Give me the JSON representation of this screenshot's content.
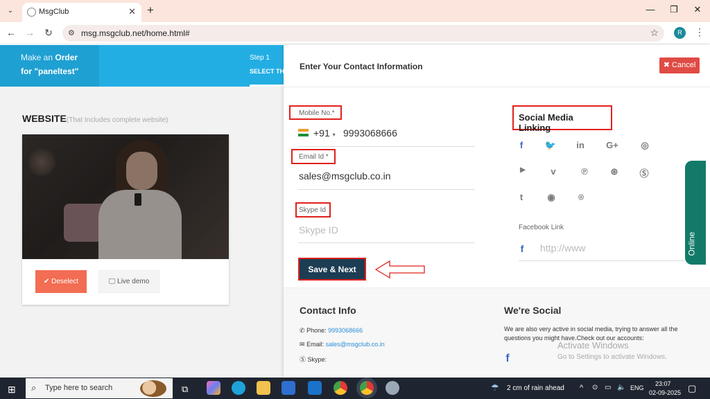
{
  "browser": {
    "tab_title": "MsgClub",
    "url": "msg.msgclub.net/home.html#",
    "profile_initial": "R"
  },
  "order_header": {
    "make_prefix": "Make an ",
    "order_word": "Order",
    "for_line": "for \"paneltest\"",
    "step": "Step 1",
    "step_title": "SELECT TH"
  },
  "website": {
    "title": "WEBSITE",
    "subtitle": "(That Includes complete website)",
    "deselect_label": "Deselect",
    "live_demo_label": "Live demo"
  },
  "panel": {
    "title": "Enter Your Contact Information",
    "cancel_label": "Cancel",
    "mobile_label": "Mobile No.*",
    "country_code": "+91",
    "mobile_value": "9993068666",
    "email_label": "Email Id *",
    "email_value": "sales@msgclub.co.in",
    "skype_label": "Skype Id",
    "skype_placeholder": "Skype ID",
    "save_label": "Save & Next",
    "social_title": "Social Media Linking",
    "facebook_label": "Facebook Link",
    "facebook_placeholder": "http://www"
  },
  "online_label": "Online",
  "footer": {
    "contact_title": "Contact Info",
    "phone_label": "Phone: ",
    "phone_value": "9993068666",
    "email_label": "Email: ",
    "email_value": "sales@msgclub.co.in",
    "skype_label": "Skype:",
    "social_title": "We're Social",
    "social_text": "We are also very active in social media, trying to answer all the questions you might have.Check out our accounts:"
  },
  "watermark": {
    "line1": "Activate Windows",
    "line2": "Go to Settings to activate Windows."
  },
  "taskbar": {
    "search_placeholder": "Type here to search",
    "weather": "2 cm of rain ahead",
    "lang": "ENG",
    "time": "23:07",
    "date": "02-09-2025"
  }
}
